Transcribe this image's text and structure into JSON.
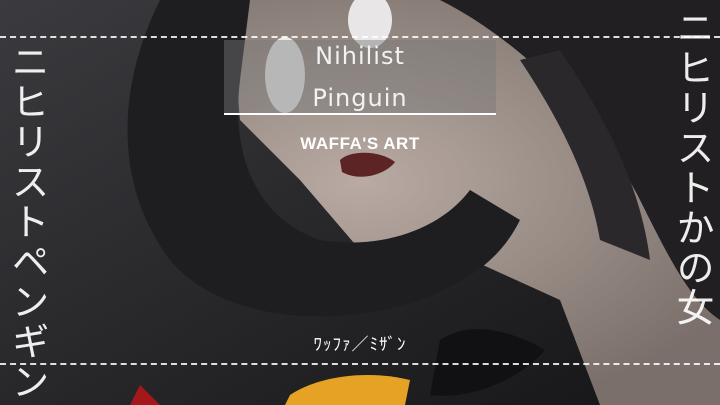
{
  "vertical_left": "ニヒリストペンギン",
  "vertical_right": "ニヒリストかの女",
  "title_line1": "Nihilist",
  "title_line2": "Pinguin",
  "credit": "WAFFA'S ART",
  "bottom_credit": "ﾜｯﾌｧ／ﾐｻﾞﾝ",
  "colors": {
    "overlay": "#7a7a7a",
    "text": "#ffffff",
    "accent_yellow": "#e7a726"
  }
}
